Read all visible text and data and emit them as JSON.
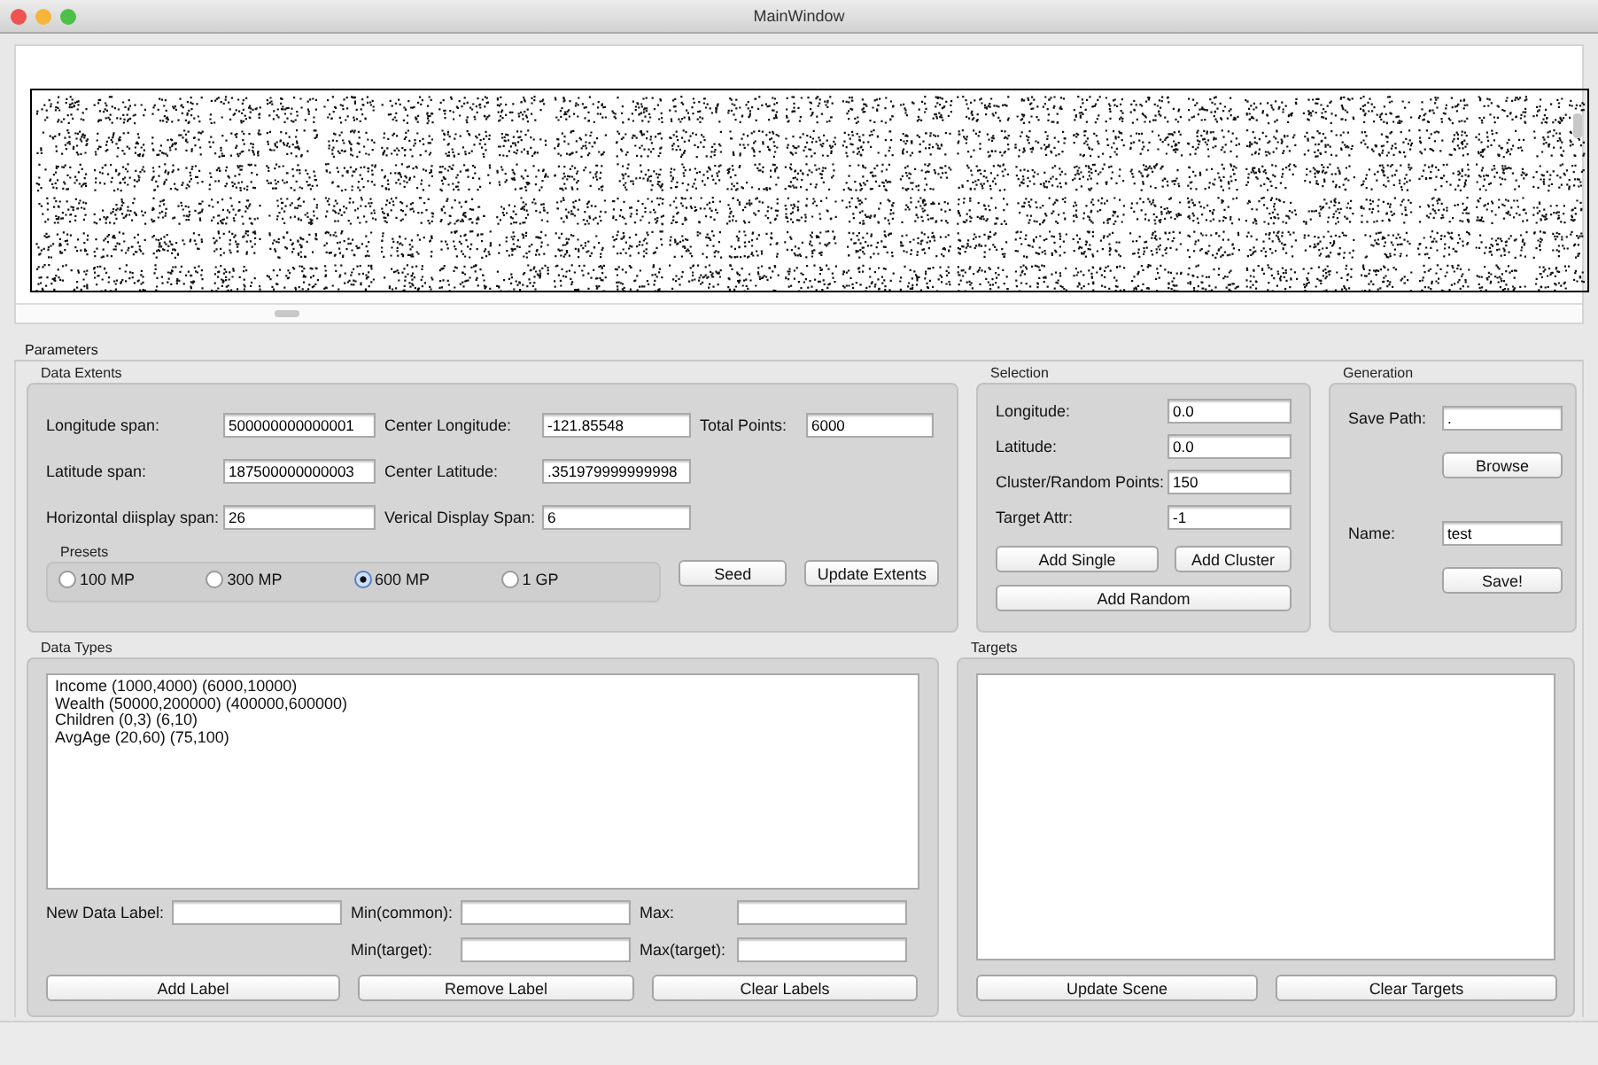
{
  "window": {
    "title": "MainWindow"
  },
  "parameters": {
    "title": "Parameters",
    "data_extents": {
      "title": "Data Extents",
      "fields": [
        {
          "label": "Longitude span:",
          "value": "500000000000001"
        },
        {
          "label": "Center Longitude:",
          "value": "-121.85548"
        },
        {
          "label": "Total Points:",
          "value": "6000"
        },
        {
          "label": "Latitude span:",
          "value": "187500000000003"
        },
        {
          "label": "Center Latitude:",
          "value": ".351979999999998"
        },
        {
          "label": "Horizontal diisplay span:",
          "value": "26"
        },
        {
          "label": "Verical Display Span:",
          "value": "6"
        }
      ],
      "presets": {
        "title": "Presets",
        "options": [
          {
            "label": "100 MP",
            "selected": false
          },
          {
            "label": "300 MP",
            "selected": false
          },
          {
            "label": "600 MP",
            "selected": true
          },
          {
            "label": "1 GP",
            "selected": false
          }
        ]
      },
      "buttons": [
        "Seed",
        "Update Extents"
      ]
    },
    "selection": {
      "title": "Selection",
      "fields": [
        {
          "label": "Longitude:",
          "value": "0.0"
        },
        {
          "label": "Latitude:",
          "value": "0.0"
        },
        {
          "label": "Cluster/Random Points:",
          "value": "150"
        },
        {
          "label": "Target Attr:",
          "value": "-1"
        }
      ],
      "buttons": [
        "Add Single",
        "Add Cluster",
        "Add Random"
      ]
    },
    "generation": {
      "title": "Generation",
      "save_path": {
        "label": "Save Path:",
        "value": "."
      },
      "browse": "Browse",
      "name": {
        "label": "Name:",
        "value": "test"
      },
      "save": "Save!"
    },
    "data_types": {
      "title": "Data Types",
      "items": [
        "Income (1000,4000) (6000,10000)",
        "Wealth (50000,200000) (400000,600000)",
        "Children (0,3) (6,10)",
        "AvgAge (20,60) (75,100)"
      ],
      "fields": [
        {
          "label": "New Data Label:"
        },
        {
          "label": "Min(common):"
        },
        {
          "label": "Max:"
        },
        {
          "label": "Min(target):"
        },
        {
          "label": "Max(target):"
        }
      ],
      "buttons": [
        "Add Label",
        "Remove Label",
        "Clear Labels"
      ]
    },
    "targets": {
      "title": "Targets",
      "buttons": [
        "Update Scene",
        "Clear Targets"
      ]
    }
  }
}
